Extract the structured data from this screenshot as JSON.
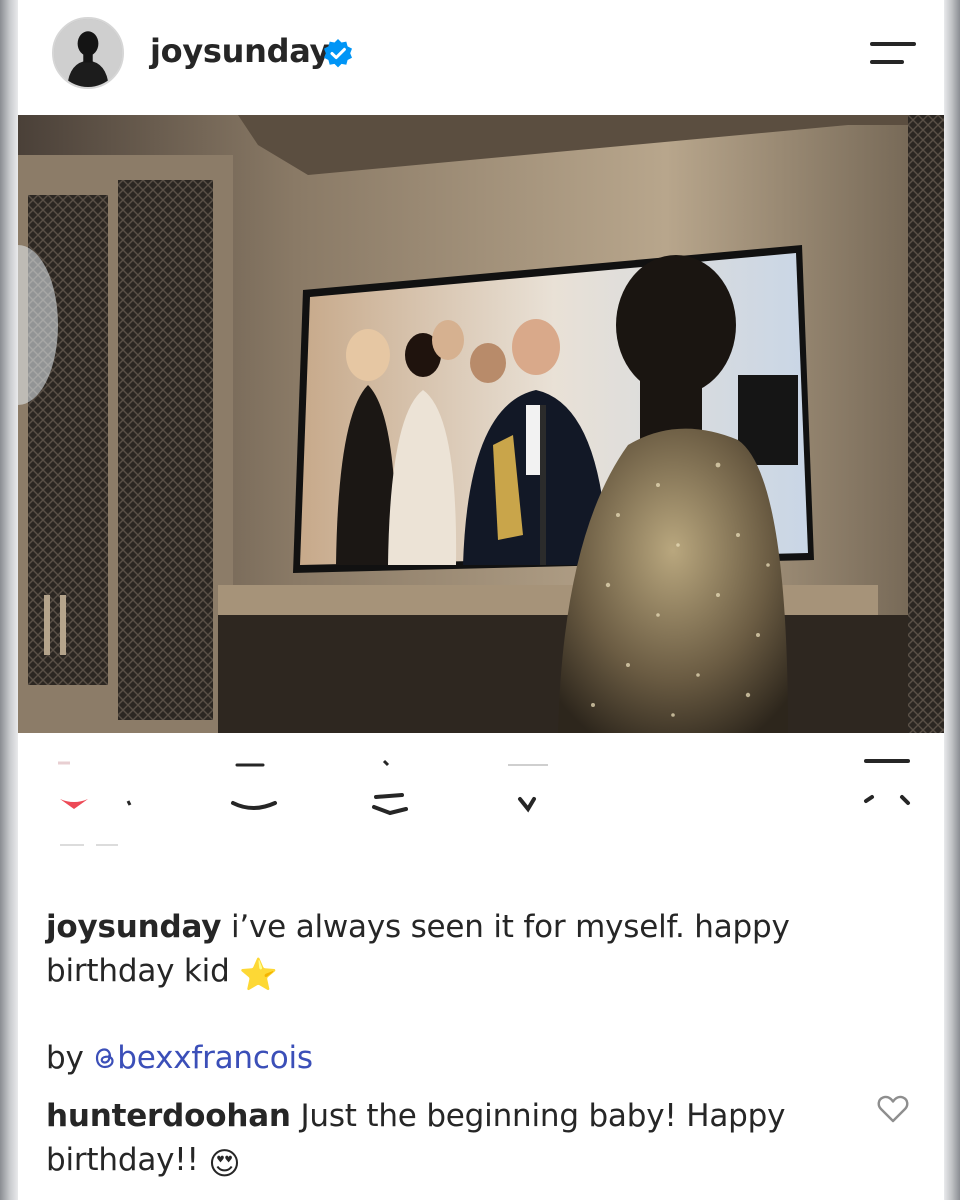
{
  "post": {
    "username": "joysunday",
    "verified": true,
    "avatar_icon": "avatar-photo",
    "menu_icon": "menu-icon"
  },
  "caption": {
    "username": "joysunday",
    "text": "i’ve always seen it for myself. happy birthday kid",
    "emoji": "⭐"
  },
  "byline": {
    "prefix": "by",
    "threads_icon": "threads-icon",
    "handle": "bexxfrancois"
  },
  "comment": {
    "username": "hunterdoohan",
    "text": "Just the beginning baby! Happy birthday!!",
    "emoji": "😍",
    "like_icon": "heart-outline-icon"
  },
  "colors": {
    "verified_blue": "#0095f6",
    "link_blue": "#3b4fb8",
    "like_red": "#ed4956",
    "text": "#262626"
  }
}
